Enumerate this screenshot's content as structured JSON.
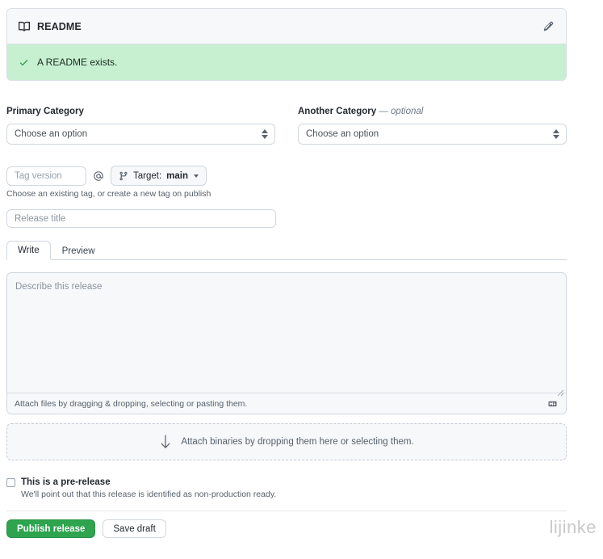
{
  "readme": {
    "icon": "book-icon",
    "title": "README",
    "edit_icon": "pencil-icon",
    "banner": {
      "icon": "check-icon",
      "text": "A README exists.",
      "bg_color": "#c6f0d0",
      "icon_color": "#2c9f4b"
    }
  },
  "categories": {
    "primary": {
      "label": "Primary Category",
      "value": "Choose an option"
    },
    "another": {
      "label": "Another Category",
      "optional_suffix": "— optional",
      "value": "Choose an option"
    }
  },
  "tag": {
    "placeholder": "Tag version",
    "value": "",
    "separator": "@",
    "target_icon": "git-branch-icon",
    "target_prefix": "Target:",
    "target_branch": "main",
    "caret_icon": "chevron-down-icon",
    "help_text": "Choose an existing tag, or create a new tag on publish"
  },
  "release": {
    "title_placeholder": "Release title",
    "title_value": ""
  },
  "tabs": [
    {
      "label": "Write",
      "active": true
    },
    {
      "label": "Preview",
      "active": false
    }
  ],
  "editor": {
    "placeholder": "Describe this release",
    "value": "",
    "footer_text": "Attach files by dragging & dropping, selecting or pasting them.",
    "markdown_icon": "markdown-icon",
    "resize_icon": "resize-grip-icon"
  },
  "dropzone": {
    "icon": "down-arrow-icon",
    "text": "Attach binaries by dropping them here or selecting them."
  },
  "prerelease": {
    "checked": false,
    "label": "This is a pre-release",
    "description": "We'll point out that this release is identified as non-production ready."
  },
  "footer": {
    "publish_label": "Publish release",
    "publish_color": "#2ea44f",
    "draft_label": "Save draft"
  },
  "watermark": "lijinke"
}
